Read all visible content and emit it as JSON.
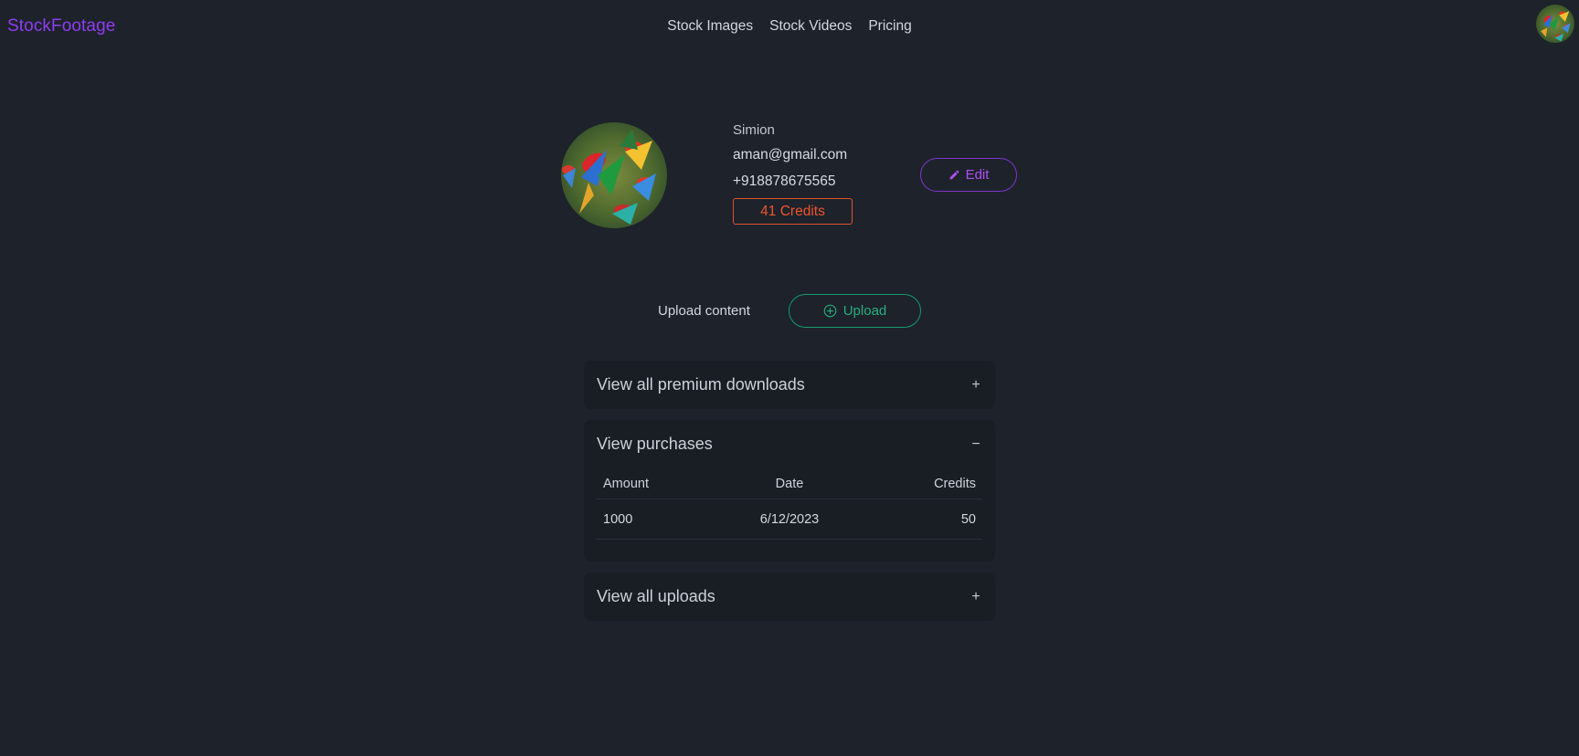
{
  "header": {
    "brand": "StockFootage",
    "nav": [
      "Stock Images",
      "Stock Videos",
      "Pricing"
    ]
  },
  "profile": {
    "name": "Simion",
    "email": "aman@gmail.com",
    "phone": "+918878675565",
    "credits_label": "41 Credits",
    "edit_label": "Edit"
  },
  "upload": {
    "label": "Upload content",
    "button_label": "Upload"
  },
  "panels": {
    "premium": {
      "title": "View all premium downloads",
      "toggle": "+"
    },
    "purchases": {
      "title": "View purchases",
      "toggle": "−",
      "columns": [
        "Amount",
        "Date",
        "Credits"
      ],
      "rows": [
        {
          "amount": "1000",
          "date": "6/12/2023",
          "credits": "50"
        }
      ]
    },
    "uploads": {
      "title": "View all uploads",
      "toggle": "+"
    }
  },
  "colors": {
    "background": "#1d222b",
    "brand": "#8f3df0",
    "credits": "#f0552d",
    "edit": "#b04ff5",
    "upload": "#26b07e"
  }
}
